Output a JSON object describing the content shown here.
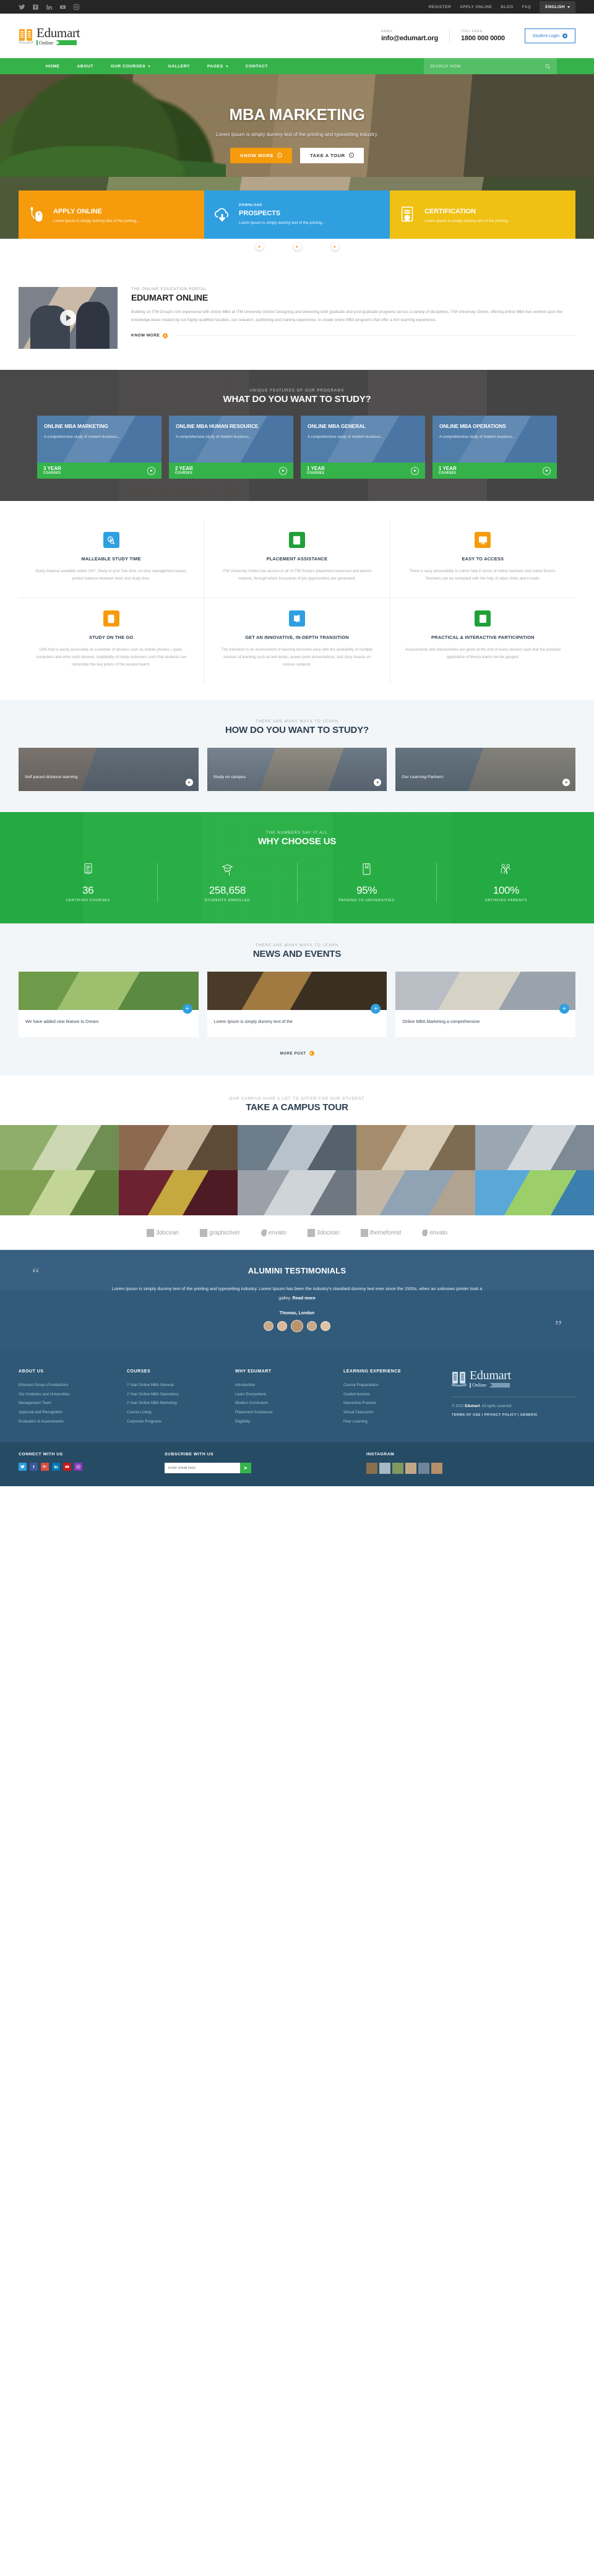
{
  "topbar": {
    "social": [
      "twitter-icon",
      "facebook-icon",
      "linkedin-icon",
      "youtube-icon",
      "instagram-icon"
    ],
    "links": [
      "REGISTER",
      "APPLY ONLINE",
      "BLOG",
      "FAQ"
    ],
    "language": "ENGLISH"
  },
  "header": {
    "logo_name": "Edumart",
    "logo_sub": "Online",
    "email_label": "EMAIL",
    "email_value": "info@edumart.org",
    "phone_label": "TOLL FREE",
    "phone_value": "1800 000 0000",
    "login_label": "Student Login"
  },
  "nav": {
    "items": [
      {
        "label": "HOME",
        "caret": false
      },
      {
        "label": "ABOUT",
        "caret": false
      },
      {
        "label": "OUR COURSES",
        "caret": true
      },
      {
        "label": "GALLERY",
        "caret": false
      },
      {
        "label": "PAGES",
        "caret": true
      },
      {
        "label": "CONTACT",
        "caret": false
      }
    ],
    "search_placeholder": "SEARCH NOW"
  },
  "hero": {
    "title": "MBA MARKETING",
    "subtitle": "Lorem Ipsum is simply dummy text of the printing and typesetting industry.",
    "btn_primary": "KNOW MORE",
    "btn_secondary": "TAKE A TOUR"
  },
  "promo": [
    {
      "kicker": "",
      "title": "APPLY ONLINE",
      "desc": "Lorem Ipsum is simply dummy text of the printing...",
      "color": "#f59b0c",
      "icon": "mouse-icon"
    },
    {
      "kicker": "DOWNLOAD",
      "title": "PROSPECTS",
      "desc": "Lorem Ipsum is simply dummy text of the printing...",
      "color": "#2f9fe0",
      "icon": "cloud-download-icon"
    },
    {
      "kicker": "",
      "title": "CERTIFICATION",
      "desc": "Lorem Ipsum is simply dummy text of the printing...",
      "color": "#f0c012",
      "icon": "certificate-icon"
    }
  ],
  "about": {
    "kicker": "THE ONLINE EDUCATION PORTAL",
    "title": "EDUMART ONLINE",
    "body": "Building on ITM Group's rich experience with online MBA at ITM University Online! Designing and delivering both graduate and post-graduate programs across a variety of disciplines, iTM University Online, offering online MBA has worked upon the knowledge-base created by our highly qualified faculties, our research, publishing and training experience, to create online MBA programs that offer a rich learning experience.",
    "cta": "KNOW MORE"
  },
  "study": {
    "kicker": "UNIQUE FEATURES OF OUR PROGRAMS",
    "title": "WHAT DO YOU WANT TO STUDY?",
    "cards": [
      {
        "title": "ONLINE MBA MARKETING",
        "desc": "A comprehensive study of modern business...",
        "years": "3 YEAR",
        "sub": "COURSES"
      },
      {
        "title": "ONLINE MBA HUMAN RESOURCE",
        "desc": "A comprehensive study of modern business...",
        "years": "2 YEAR",
        "sub": "COURSES"
      },
      {
        "title": "ONLINE MBA GENERAL",
        "desc": "A comprehensive study of modern business...",
        "years": "1 YEAR",
        "sub": "COURSES"
      },
      {
        "title": "ONLINE MBA OPERATIONS",
        "desc": "A comprehensive study of modern business...",
        "years": "1 YEAR",
        "sub": "COURSES"
      }
    ]
  },
  "features": [
    {
      "title": "MALLEABLE STUDY TIME",
      "desc": "Study material available online 24/7. Study in your free time, no time management issues, perfect balance between work and study time.",
      "color": "#2f9fe0",
      "icon": "search-clock-icon"
    },
    {
      "title": "PLACEMENT ASSISTANCE",
      "desc": "ITM University Online has access to all of ITM Group's placement resources and alumni network, through which thousands of job opportunities are generated.",
      "color": "#1fa038",
      "icon": "person-search-icon"
    },
    {
      "title": "EASY TO ACCESS",
      "desc": "There is easy accessibility to online help in terms of online teachers and online forums. Teachers can be contacted with the help of video chats and e-mails.",
      "color": "#f59b0c",
      "icon": "monitor-chat-icon"
    },
    {
      "title": "STUDY ON THE GO",
      "desc": "LMS that is easily accessible on a number of devices such as mobile phones, i-pads, computers and other such devices. Availability of ready reckoners such that students can remember the key points of the session learnt.",
      "color": "#f59b0c",
      "icon": "mobile-book-icon"
    },
    {
      "title": "GET AN INNOVATIVE, IN-DEPTH TRANSITION",
      "desc": "The transition to an environment of learning becomes easy with the availability of multiple sources of learning such as text books, power-point presentations, and story boards on various subjects.",
      "color": "#2f9fe0",
      "icon": "open-book-icon"
    },
    {
      "title": "PRACTICAL & INTERACTIVE PARTICIPATION",
      "desc": "Assessments and interactivities are given at the end of every session such that the practical application of theory learnt can be gauged.",
      "color": "#1fa038",
      "icon": "notebook-icon"
    }
  ],
  "howstudy": {
    "kicker": "THERE ARE MANY WAYS TO LEARN",
    "title": "HOW DO YOU WANT TO STUDY?",
    "cards": [
      {
        "label": "Self paced distance learning"
      },
      {
        "label": "Study on campus"
      },
      {
        "label": "Our Learning Partners"
      }
    ]
  },
  "why": {
    "kicker": "THE NUMBERS SAY IT ALL",
    "title": "WHY CHOOSE US",
    "stats": [
      {
        "value": "36",
        "label": "CERTIFIED COURSES",
        "icon": "certificate-icon"
      },
      {
        "value": "258,658",
        "label": "STUDENTS ENROLLED",
        "icon": "graduate-icon"
      },
      {
        "value": "95%",
        "label": "PASSING TO UNIVERSITIES",
        "icon": "book-icon"
      },
      {
        "value": "100%",
        "label": "SATISFIED PARENTS",
        "icon": "family-icon"
      }
    ]
  },
  "news": {
    "kicker": "THERE ARE MANY WAYS TO LEARN",
    "title": "NEWS AND EVENTS",
    "posts": [
      {
        "text": "We have added new feature to Dream"
      },
      {
        "text": "Lorem Ipsum is simply dummy text of the"
      },
      {
        "text": "Online MBA Marketing a comprehensive"
      }
    ],
    "more_label": "MORE POST"
  },
  "tour": {
    "kicker": "OUR CAMPUS HAVE A LOT TO OFFER FOR OUR STUDENT",
    "title": "TAKE A CAMPUS TOUR"
  },
  "brands": [
    {
      "name": "3docean"
    },
    {
      "name": "graphicriver"
    },
    {
      "name": "envato"
    },
    {
      "name": "3docean"
    },
    {
      "name": "themeforest"
    },
    {
      "name": "envato"
    }
  ],
  "testimonial": {
    "title": "ALUMINI TESTIMONIALS",
    "quote": "Lorem Ipsum is simply dummy text of the printing and typesetting industry. Lorem Ipsum has been the industry's standard dummy text ever since the 1500s, when an unknown printer took a galley.",
    "readmore": "Read more",
    "author": "Thomas, London"
  },
  "footer": {
    "columns": [
      {
        "title": "ABOUT US",
        "links": [
          "Edumart Group of Institutions",
          "Our Institutes and Universities",
          "Management Team",
          "Approval and Recognition",
          "Evaluation & Assessments"
        ]
      },
      {
        "title": "COURSES",
        "links": [
          "2 Year Online MBA General",
          "2 Year Online MBA Operations",
          "2 Year Online MBA Marketing",
          "Course Listing",
          "Corporate Programs"
        ]
      },
      {
        "title": "WHY EDUMART",
        "links": [
          "Introduction",
          "Learn Everywhere",
          "Modern Curriculum",
          "Placement Assistance",
          "Eligibility"
        ]
      },
      {
        "title": "LEARNING EXPERIENCE",
        "links": [
          "Course Preparations",
          "Guided lessons",
          "Interactive Practice",
          "Virtual Classroom",
          "Peer Learning"
        ]
      }
    ],
    "logo_name": "Edumart",
    "logo_sub": "Online",
    "copyright_pre": "© 2022 ",
    "copyright_brand": "Edumart",
    "copyright_post": ". All rights reserved",
    "legal": "TERMS OF USE | PRIVACY POLICY | GENERIC"
  },
  "bottom": {
    "connect_title": "CONNECT WITH US",
    "subscribe_title": "SUBSCRIBE WITH US",
    "subscribe_placeholder": "Enter email here",
    "instagram_title": "INSTAGRAM"
  }
}
